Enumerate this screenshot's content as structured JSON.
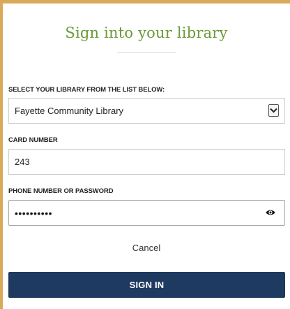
{
  "title": "Sign into your library",
  "library": {
    "label": "SELECT YOUR LIBRARY FROM THE LIST BELOW:",
    "selected": "Fayette Community Library"
  },
  "card_number": {
    "label": "CARD NUMBER",
    "value": "243"
  },
  "password": {
    "label": "PHONE NUMBER OR PASSWORD",
    "masked_value": "••••••••••"
  },
  "cancel_label": "Cancel",
  "signin_label": "SIGN IN",
  "icons": {
    "select": "chevron-down-icon",
    "reveal": "eye-icon"
  },
  "colors": {
    "frame": "#d9a95a",
    "title": "#6a9a36",
    "primary_button": "#1f3a60"
  }
}
